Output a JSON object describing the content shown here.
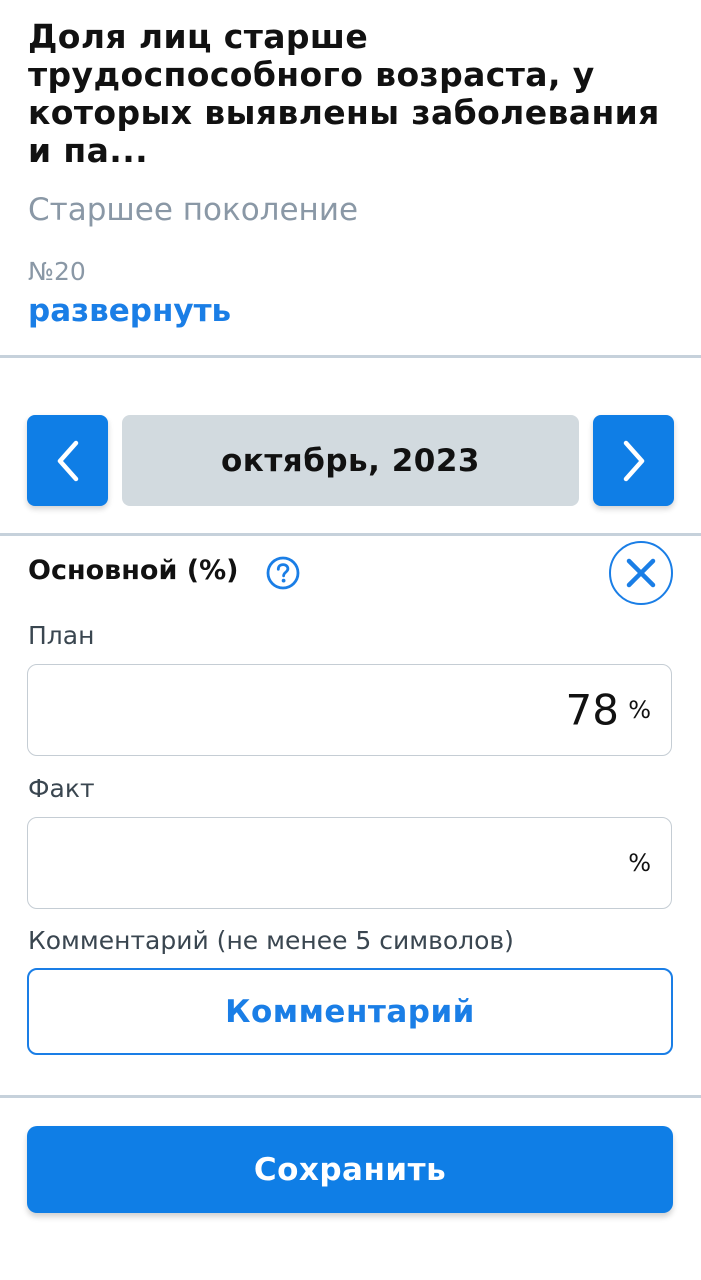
{
  "header": {
    "title": "Доля лиц старше трудоспособного возраста, у которых выявлены заболевания и па...",
    "subtitle": "Старшее поколение",
    "number": "№20",
    "expand_label": "развернуть"
  },
  "period": {
    "current": "октябрь, 2023",
    "prev_icon": "chevron-left-icon",
    "next_icon": "chevron-right-icon"
  },
  "section": {
    "title": "Основной (%)",
    "help_icon": "question-circle-icon",
    "close_icon": "close-circle-icon"
  },
  "fields": {
    "plan": {
      "label": "План",
      "value": "78",
      "unit": "%"
    },
    "fact": {
      "label": "Факт",
      "value": "",
      "unit": "%"
    },
    "comment": {
      "label": "Комментарий (не менее 5 символов)",
      "button_label": "Комментарий"
    }
  },
  "actions": {
    "save_label": "Сохранить"
  },
  "colors": {
    "accent": "#0f7ee6",
    "link": "#1a7ee6",
    "muted_text": "#8a98a6",
    "divider": "#c6d1db",
    "month_bg": "#d2dadf"
  }
}
